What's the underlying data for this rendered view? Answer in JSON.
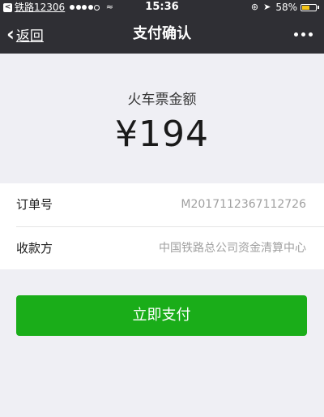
{
  "status_bar": {
    "back_app": "铁路12306",
    "back_badge": "<",
    "time": "15:36",
    "wifi": "≈",
    "lock_icon": "⊛",
    "location_icon": "➤",
    "battery": "58%"
  },
  "nav": {
    "back_label": "返回",
    "title": "支付确认"
  },
  "payment": {
    "amount_title": "火车票金额",
    "amount": "¥194"
  },
  "details": [
    {
      "label": "订单号",
      "value": "M2017112367112726"
    },
    {
      "label": "收款方",
      "value": "中国铁路总公司资金清算中心"
    }
  ],
  "pay_button_label": "立即支付",
  "colors": {
    "nav_bg": "#2f2f34",
    "page_bg": "#efeff4",
    "pay_green": "#1aad19",
    "battery_yellow": "#f5c518"
  },
  "battery_level": 0.58
}
